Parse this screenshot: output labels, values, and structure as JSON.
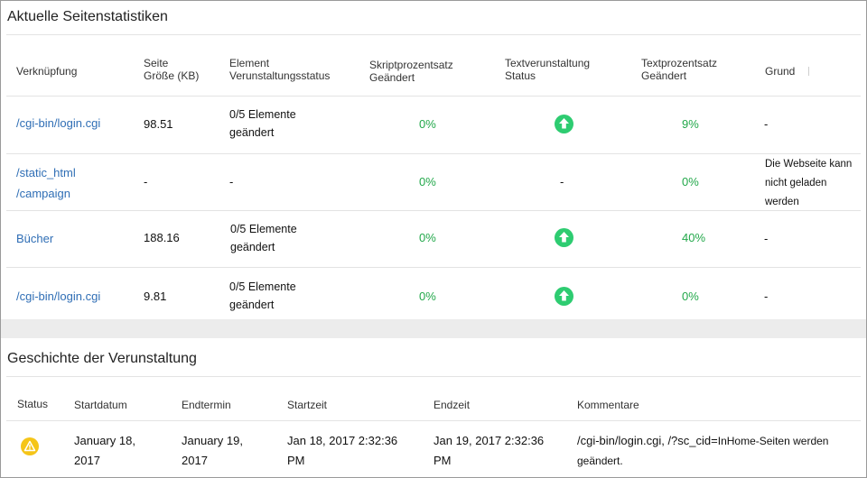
{
  "stats": {
    "title": "Aktuelle Seitenstatistiken",
    "headers": {
      "link": "Verknüpfung",
      "size_l1": "Seite",
      "size_l2": "Größe (KB)",
      "elem_l1": "Element",
      "elem_l2": "Verunstaltungsstatus",
      "script_l1": "Skriptprozentsatz",
      "script_l2": "Geändert",
      "textstat_l1": "Textverunstaltung",
      "textstat_l2": "Status",
      "textpct_l1": "Textprozentsatz",
      "textpct_l2": "Geändert",
      "reason": "Grund"
    },
    "rows": [
      {
        "link": "/cgi-bin/login.cgi",
        "size": "98.51",
        "elem_l1": "0/5 Elemente",
        "elem_l2": "geändert",
        "script": "0%",
        "text_status": "up-arrow-icon",
        "text_pct": "9%",
        "reason": "-"
      },
      {
        "link_l1": "/static_html",
        "link_l2": "/campaign",
        "size": "-",
        "elem": "-",
        "script": "0%",
        "text_status_text": "-",
        "text_pct": "0%",
        "reason_l1": "Die Webseite kann",
        "reason_l2": "nicht geladen",
        "reason_l3": "werden"
      },
      {
        "link": "Bücher",
        "size": "188.16",
        "elem_l1": "0/5 Elemente",
        "elem_l2": "geändert",
        "script": "0%",
        "text_status": "up-arrow-icon",
        "text_pct": "40%",
        "reason": "-"
      },
      {
        "link": "/cgi-bin/login.cgi",
        "size": "9.81",
        "elem_l1": "0/5 Elemente",
        "elem_l2": "geändert",
        "script": "0%",
        "text_status": "up-arrow-icon",
        "text_pct": "0%",
        "reason": "-"
      }
    ]
  },
  "history": {
    "title": "Geschichte der Verunstaltung",
    "headers": {
      "status": "Status",
      "start_date": "Startdatum",
      "end_date": "Endtermin",
      "start_time": "Startzeit",
      "end_time": "Endzeit",
      "comments": "Kommentare"
    },
    "rows": [
      {
        "status_icon": "warning-icon",
        "start_date_l1": "January 18,",
        "start_date_l2": "2017",
        "end_date_l1": "January 19,",
        "end_date_l2": "2017",
        "start_time_l1": "Jan 18, 2017 2:32:36",
        "start_time_l2": "PM",
        "end_time_l1": "Jan 19, 2017 2:32:36",
        "end_time_l2": "PM",
        "comment_part1": "/cgi-bin/login.cgi, /?sc_cid=",
        "comment_part2": "InHome-Seiten werden",
        "comment_l2": "geändert."
      }
    ]
  },
  "colors": {
    "link": "#2f6eb5",
    "percent": "#22a84a",
    "status_ok": "#2ecc71",
    "warning": "#f5c518",
    "band": "#ececec"
  }
}
